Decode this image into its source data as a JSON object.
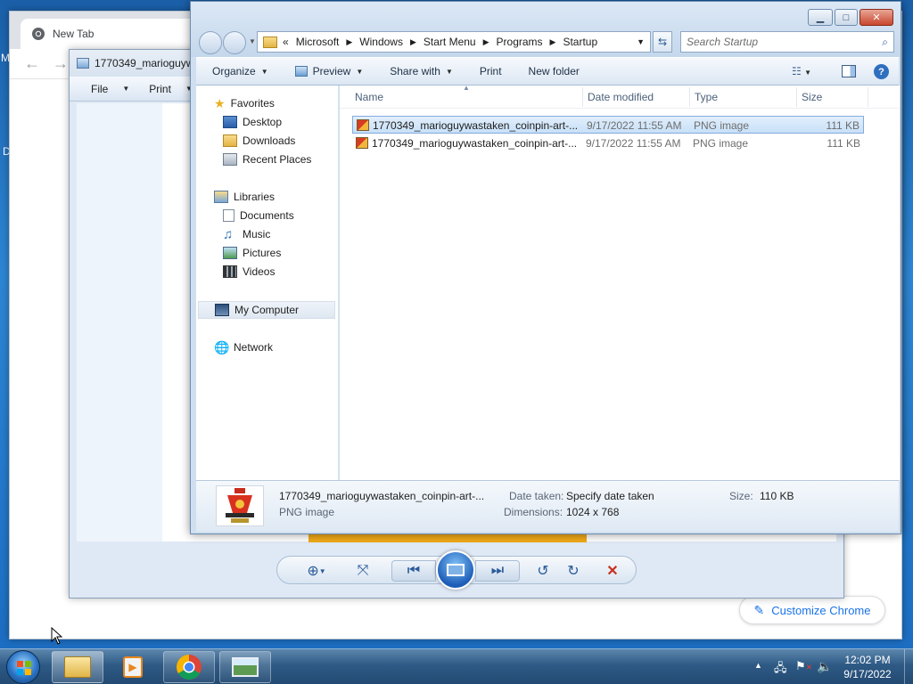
{
  "desktop": {
    "edge_letters": [
      "M",
      "D"
    ]
  },
  "chrome": {
    "tab_title": "New Tab",
    "customize_label": "Customize Chrome"
  },
  "viewer": {
    "title": "1770349_marioguywastaken_coinpin-art-...",
    "menu": {
      "file": "File",
      "print": "Print"
    }
  },
  "explorer": {
    "breadcrumb": [
      "Microsoft",
      "Windows",
      "Start Menu",
      "Programs",
      "Startup"
    ],
    "breadcrumb_prefix": "«",
    "search_placeholder": "Search Startup",
    "commands": {
      "organize": "Organize",
      "preview": "Preview",
      "share_with": "Share with",
      "print": "Print",
      "new_folder": "New folder"
    },
    "nav": {
      "favorites": "Favorites",
      "desktop": "Desktop",
      "downloads": "Downloads",
      "recent_places": "Recent Places",
      "libraries": "Libraries",
      "documents": "Documents",
      "music": "Music",
      "pictures": "Pictures",
      "videos": "Videos",
      "my_computer": "My Computer",
      "network": "Network"
    },
    "columns": {
      "name": "Name",
      "date": "Date modified",
      "type": "Type",
      "size": "Size"
    },
    "files": [
      {
        "name": "1770349_marioguywastaken_coinpin-art-...",
        "date": "9/17/2022 11:55 AM",
        "type": "PNG image",
        "size": "111 KB",
        "selected": true
      },
      {
        "name": "1770349_marioguywastaken_coinpin-art-...",
        "date": "9/17/2022 11:55 AM",
        "type": "PNG image",
        "size": "111 KB",
        "selected": false
      }
    ],
    "details": {
      "filename": "1770349_marioguywastaken_coinpin-art-...",
      "filetype": "PNG image",
      "date_taken_label": "Date taken:",
      "date_taken_value": "Specify date taken",
      "size_label": "Size:",
      "size_value": "110 KB",
      "dimensions_label": "Dimensions:",
      "dimensions_value": "1024 x 768"
    }
  },
  "taskbar": {
    "time": "12:02 PM",
    "date": "9/17/2022"
  },
  "colors": {
    "desktop_blue": "#1b6bc0",
    "selection_border": "#84acdd",
    "chrome_accent": "#1a73e8",
    "close_red": "#c8452d"
  }
}
